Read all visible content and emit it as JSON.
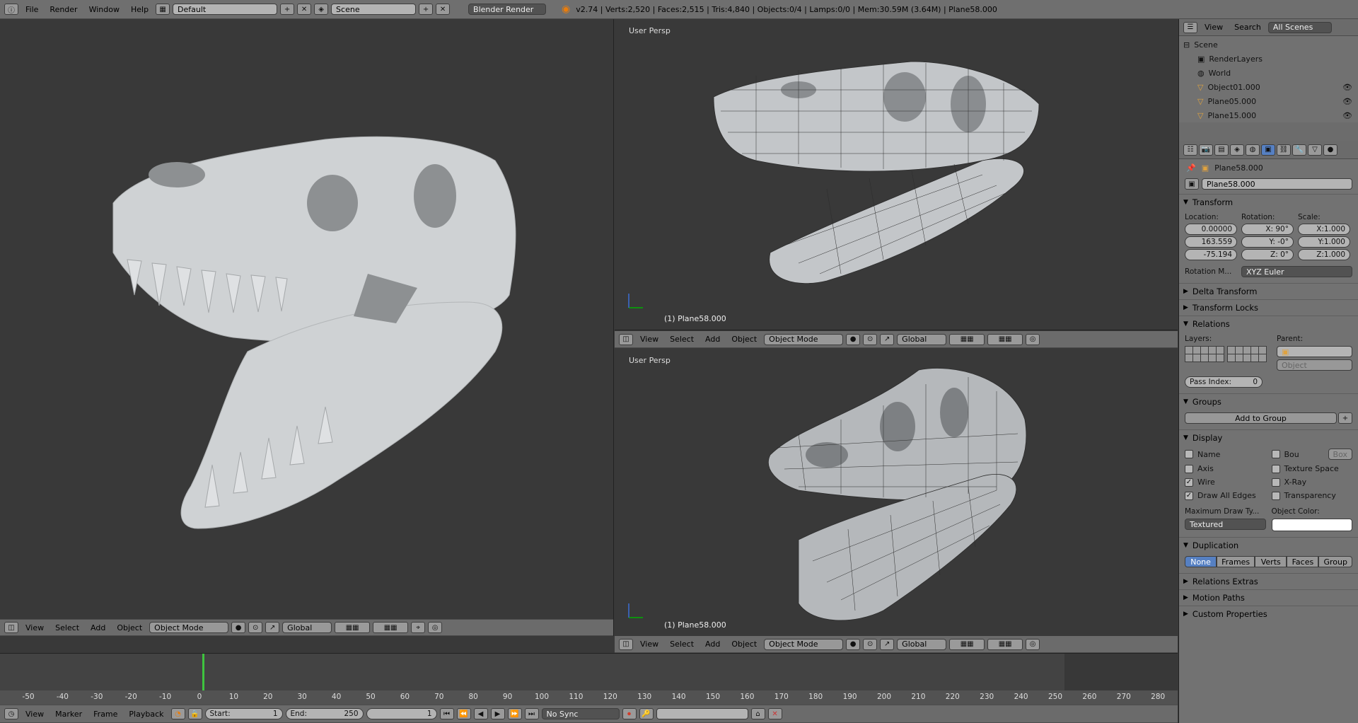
{
  "topbar": {
    "menus": [
      "File",
      "Render",
      "Window",
      "Help"
    ],
    "layout": "Default",
    "scene": "Scene",
    "engine": "Blender Render",
    "stats": "v2.74 | Verts:2,520 | Faces:2,515 | Tris:4,840 | Objects:0/4 | Lamps:0/0 | Mem:30.59M (3.64M) | Plane58.000"
  },
  "viewports": {
    "left": {},
    "top_right": {
      "label": "User Persp",
      "object": "(1) Plane58.000"
    },
    "bottom_right": {
      "label": "User Persp",
      "object": "(1) Plane58.000"
    },
    "header_menus": [
      "View",
      "Select",
      "Add",
      "Object"
    ],
    "mode": "Object Mode",
    "orientation": "Global"
  },
  "outliner": {
    "menus": [
      "View",
      "Search"
    ],
    "filter": "All Scenes",
    "items": [
      "Scene",
      "RenderLayers",
      "World",
      "Object01.000",
      "Plane05.000",
      "Plane15.000"
    ]
  },
  "properties": {
    "object_name": "Plane58.000",
    "object_field": "Plane58.000",
    "transform": {
      "title": "Transform",
      "location_label": "Location:",
      "rotation_label": "Rotation:",
      "scale_label": "Scale:",
      "location": [
        "0.00000",
        "163.559",
        "-75.194"
      ],
      "rotation": [
        "X:  90°",
        "Y:  -0°",
        "Z:   0°"
      ],
      "scale": [
        "X:1.000",
        "Y:1.000",
        "Z:1.000"
      ],
      "rotation_mode_label": "Rotation M...",
      "rotation_mode": "XYZ Euler"
    },
    "collapsed_1": [
      "Delta Transform",
      "Transform Locks"
    ],
    "relations": {
      "title": "Relations",
      "layers_label": "Layers:",
      "parent_label": "Parent:",
      "parent_type": "Object",
      "pass_index_label": "Pass Index:",
      "pass_index": "0"
    },
    "groups": {
      "title": "Groups",
      "add_button": "Add to Group"
    },
    "display": {
      "title": "Display",
      "left": [
        {
          "label": "Name",
          "checked": false
        },
        {
          "label": "Axis",
          "checked": false
        },
        {
          "label": "Wire",
          "checked": true
        },
        {
          "label": "Draw All Edges",
          "checked": true
        }
      ],
      "right": [
        {
          "label": "Bou",
          "checked": false
        },
        {
          "label": "Texture Space",
          "checked": false
        },
        {
          "label": "X-Ray",
          "checked": false
        },
        {
          "label": "Transparency",
          "checked": false
        }
      ],
      "bounds_type": "Box",
      "max_draw_label": "Maximum Draw Ty...",
      "max_draw": "Textured",
      "object_color_label": "Object Color:"
    },
    "duplication": {
      "title": "Duplication",
      "options": [
        "None",
        "Frames",
        "Verts",
        "Faces",
        "Group"
      ],
      "active": "None"
    },
    "collapsed_2": [
      "Relations Extras",
      "Motion Paths",
      "Custom Properties"
    ]
  },
  "timeline": {
    "ticks": [
      "-50",
      "-40",
      "-30",
      "-20",
      "-10",
      "0",
      "10",
      "20",
      "30",
      "40",
      "50",
      "60",
      "70",
      "80",
      "90",
      "100",
      "110",
      "120",
      "130",
      "140",
      "150",
      "160",
      "170",
      "180",
      "190",
      "200",
      "210",
      "220",
      "230",
      "240",
      "250",
      "260",
      "270",
      "280"
    ],
    "menus": [
      "View",
      "Marker",
      "Frame",
      "Playback"
    ],
    "start_label": "Start:",
    "start": "1",
    "end_label": "End:",
    "end": "250",
    "current": "1",
    "sync": "No Sync"
  },
  "colors": {
    "accent": "#5680c2",
    "timeline_cursor": "#3ec43e",
    "viewport_bg": "#393939",
    "panel_bg": "#727272"
  }
}
